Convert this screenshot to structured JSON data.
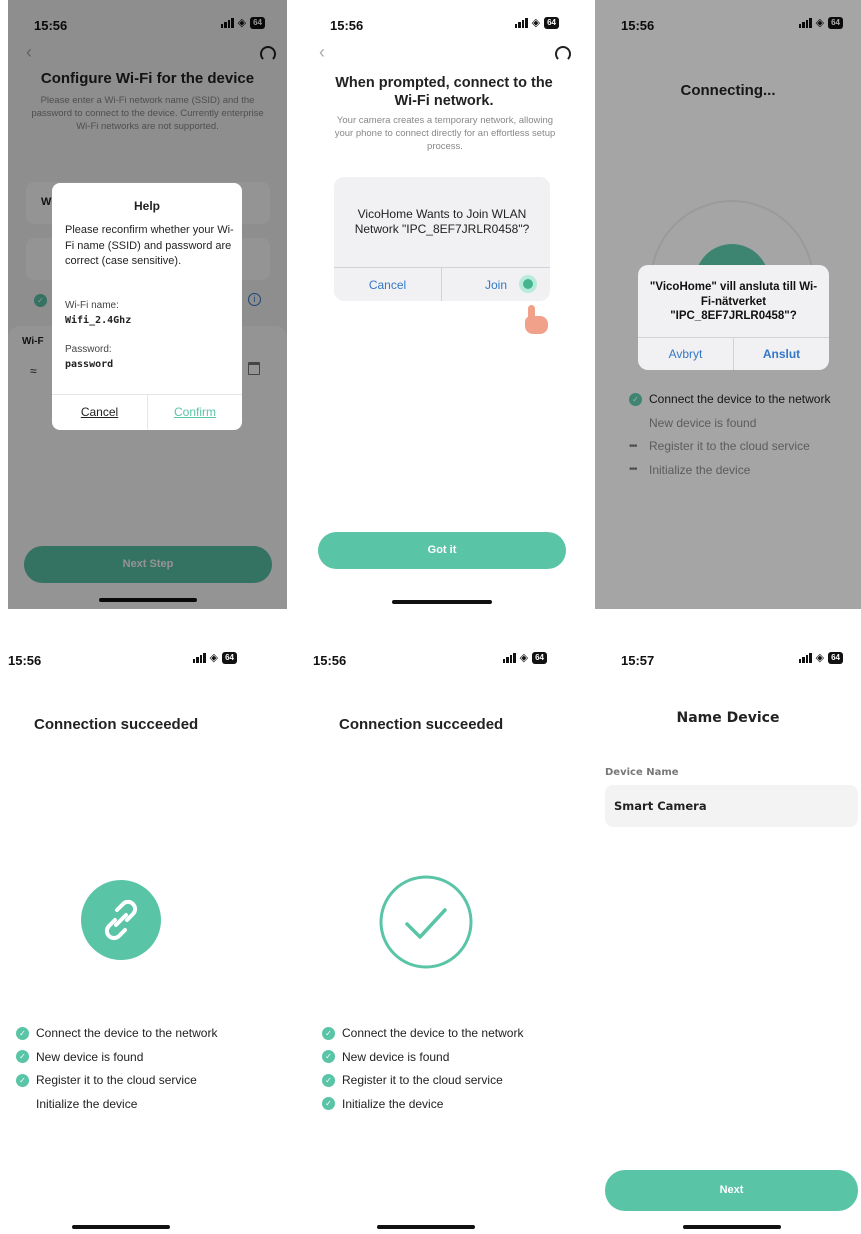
{
  "colors": {
    "accent": "#5ac4a7",
    "ios_blue": "#3478c6"
  },
  "panel1": {
    "time": "15:56",
    "battery": "64",
    "title": "Configure Wi-Fi for the device",
    "subtitle": "Please enter a Wi-Fi network name (SSID) and the password to connect to the device. Currently enterprise Wi-Fi networks are not supported.",
    "bg_row_label": "Wi-F",
    "bg_field_letter": "W",
    "next_label": "Next Step",
    "dialog": {
      "title": "Help",
      "body": "Please reconfirm whether your Wi-Fi name (SSID) and password are correct (case sensitive).",
      "wifi_label": "Wi-Fi name:",
      "wifi_value": "Wifi_2.4Ghz",
      "password_label": "Password:",
      "password_value": "password",
      "cancel": "Cancel",
      "confirm": "Confirm"
    }
  },
  "panel2": {
    "time": "15:56",
    "battery": "64",
    "title": "When prompted, connect to the Wi-Fi network.",
    "subtitle": "Your camera creates a temporary network, allowing your phone to connect directly for an effortless setup process.",
    "alert_text": "VicoHome Wants to Join WLAN Network \"IPC_8EF7JRLR0458\"?",
    "cancel": "Cancel",
    "join": "Join",
    "got_it": "Got it"
  },
  "panel3": {
    "time": "15:56",
    "battery": "64",
    "title": "Connecting...",
    "alert_text": "\"VicoHome\" vill ansluta till Wi-Fi-nätverket \"IPC_8EF7JRLR0458\"?",
    "cancel": "Avbryt",
    "confirm": "Anslut",
    "steps": [
      {
        "label": "Connect the device to the network",
        "state": "done"
      },
      {
        "label": "New device is found",
        "state": "current"
      },
      {
        "label": "Register it to the cloud service",
        "state": "pending"
      },
      {
        "label": "Initialize the device",
        "state": "pending"
      }
    ]
  },
  "panel4": {
    "time": "15:56",
    "battery": "64",
    "title": "Connection succeeded",
    "steps": [
      {
        "label": "Connect the device to the network",
        "state": "done"
      },
      {
        "label": "New device is found",
        "state": "done"
      },
      {
        "label": "Register it to the cloud service",
        "state": "done"
      },
      {
        "label": "Initialize the device",
        "state": "current"
      }
    ]
  },
  "panel5": {
    "time": "15:56",
    "battery": "64",
    "title": "Connection succeeded",
    "steps": [
      {
        "label": "Connect the device to the network",
        "state": "done"
      },
      {
        "label": "New device is found",
        "state": "done"
      },
      {
        "label": "Register it to the cloud service",
        "state": "done"
      },
      {
        "label": "Initialize the device",
        "state": "done"
      }
    ]
  },
  "panel6": {
    "time": "15:57",
    "battery": "64",
    "title": "Name Device",
    "field_label": "Device Name",
    "field_value": "Smart Camera",
    "next": "Next"
  }
}
